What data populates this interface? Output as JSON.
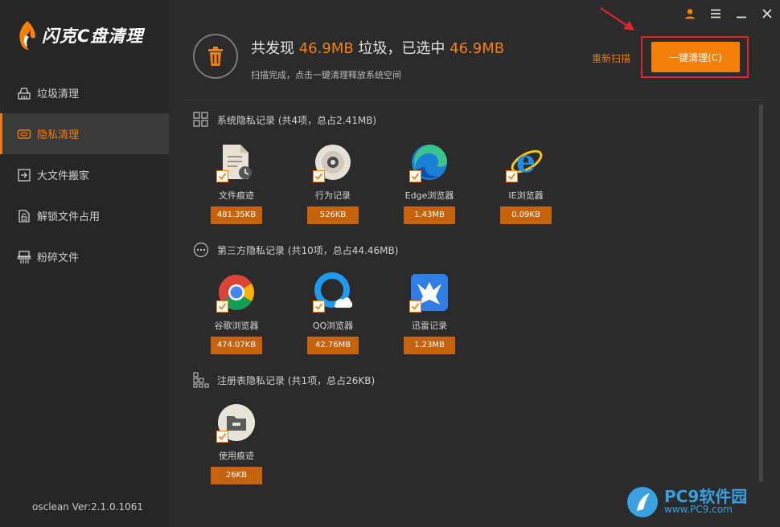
{
  "app": {
    "logo_text": "闪克C盘清理",
    "version": "osclean Ver:2.1.0.1061"
  },
  "sidebar": {
    "items": [
      {
        "label": "垃圾清理",
        "icon": "broom-icon",
        "active": false
      },
      {
        "label": "隐私清理",
        "icon": "privacy-icon",
        "active": true
      },
      {
        "label": "大文件搬家",
        "icon": "move-file-icon",
        "active": false
      },
      {
        "label": "解锁文件占用",
        "icon": "unlock-file-icon",
        "active": false
      },
      {
        "label": "粉碎文件",
        "icon": "shredder-icon",
        "active": false
      }
    ]
  },
  "header": {
    "summary_prefix": "共发现",
    "found_size": "46.9MB",
    "summary_mid": "垃圾，已选中",
    "selected_size": "46.9MB",
    "subtext": "扫描完成，点击一键清理释放系统空间",
    "rescan_label": "重新扫描",
    "clean_label": "一键清理(C)"
  },
  "sections": [
    {
      "title": "系统隐私记录 (共4项，总占2.41MB)",
      "items": [
        {
          "name": "文件痕迹",
          "size": "481.35KB",
          "icon": "file-trace-icon"
        },
        {
          "name": "行为记录",
          "size": "526KB",
          "icon": "disc-icon"
        },
        {
          "name": "Edge浏览器",
          "size": "1.43MB",
          "icon": "edge-icon"
        },
        {
          "name": "IE浏览器",
          "size": "0.09KB",
          "icon": "ie-icon"
        }
      ]
    },
    {
      "title": "第三方隐私记录 (共10项，总占44.46MB)",
      "items": [
        {
          "name": "谷歌浏览器",
          "size": "474.07KB",
          "icon": "chrome-icon"
        },
        {
          "name": "QQ浏览器",
          "size": "42.76MB",
          "icon": "qq-browser-icon"
        },
        {
          "name": "迅雷记录",
          "size": "1.23MB",
          "icon": "xunlei-icon"
        }
      ]
    },
    {
      "title": "注册表隐私记录 (共1项，总占26KB)",
      "items": [
        {
          "name": "使用痕迹",
          "size": "26KB",
          "icon": "registry-icon"
        }
      ]
    }
  ],
  "watermark": {
    "brand": "PC9软件园",
    "url": "www.PC9.com"
  },
  "colors": {
    "accent": "#f57f17",
    "size_badge": "#c5620d",
    "highlight_frame": "#e1242a",
    "background": "#2b2b2b",
    "sidebar": "#262626"
  }
}
